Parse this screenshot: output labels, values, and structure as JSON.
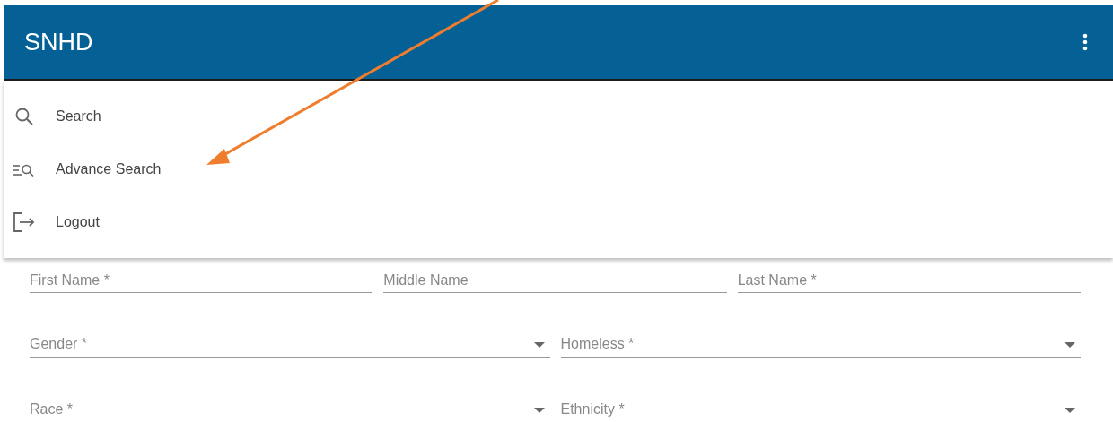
{
  "app_bar": {
    "title": "SNHD"
  },
  "menu": {
    "items": [
      {
        "kind": "search",
        "label": "Search"
      },
      {
        "kind": "advanced-search",
        "label": "Advance Search"
      },
      {
        "kind": "logout",
        "label": "Logout"
      }
    ]
  },
  "form": {
    "rows": [
      [
        {
          "kind": "text",
          "placeholder": "First Name *"
        },
        {
          "kind": "text",
          "placeholder": "Middle Name"
        },
        {
          "kind": "text",
          "placeholder": "Last Name *"
        }
      ],
      [
        {
          "kind": "select",
          "placeholder": "Gender *"
        },
        {
          "kind": "select",
          "placeholder": "Homeless *"
        }
      ],
      [
        {
          "kind": "select",
          "placeholder": "Race *"
        },
        {
          "kind": "select",
          "placeholder": "Ethnicity *"
        }
      ]
    ]
  }
}
